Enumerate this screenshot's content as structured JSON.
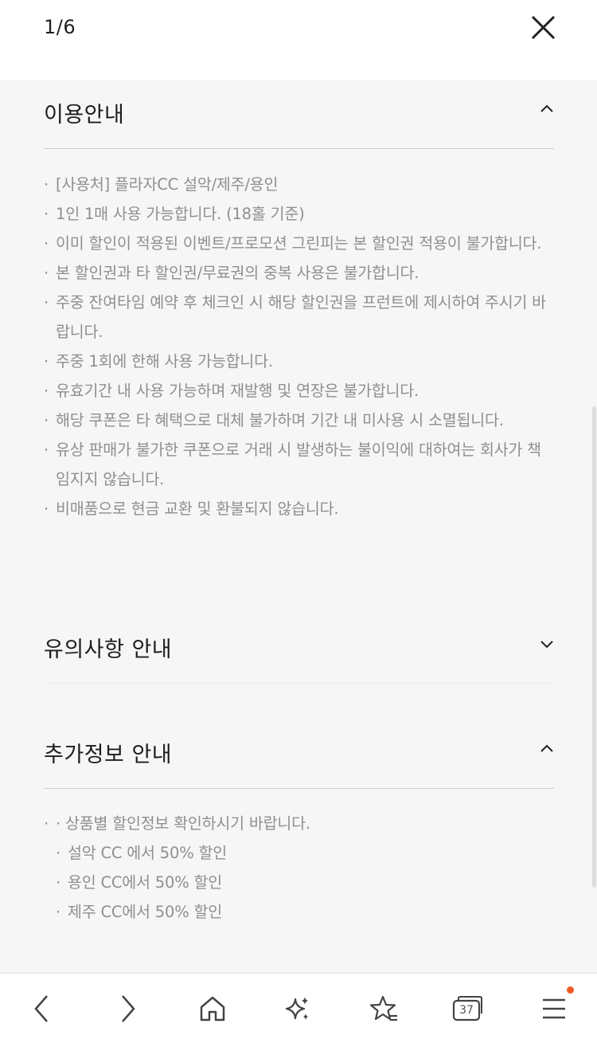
{
  "header": {
    "page_counter": "1/6",
    "close_icon": "close-icon"
  },
  "sections": {
    "usage": {
      "title": "이용안내",
      "state_icon": "chevron-up-icon",
      "items": [
        "[사용처] 플라자CC 설악/제주/용인",
        "1인 1매 사용 가능합니다. (18홀 기준)",
        "이미 할인이 적용된 이벤트/프로모션 그린피는 본 할인권 적용이 불가합니다.",
        "본 할인권과 타 할인권/무료권의 중복 사용은 불가합니다.",
        "주중 잔여타임 예약 후 체크인 시 해당 할인권을 프런트에 제시하여 주시기 바랍니다.",
        "주중 1회에 한해 사용 가능합니다.",
        "유효기간 내 사용 가능하며 재발행 및 연장은 불가합니다.",
        "해당 쿠폰은 타 혜택으로 대체 불가하며 기간 내 미사용 시 소멸됩니다.",
        "유상 판매가 불가한 쿠폰으로 거래 시 발생하는 불이익에 대하여는 회사가 책임지지 않습니다.",
        "비매품으로 현금 교환 및 환불되지 않습니다."
      ]
    },
    "caution": {
      "title": "유의사항 안내",
      "state_icon": "chevron-down-icon"
    },
    "extra": {
      "title": "추가정보 안내",
      "state_icon": "chevron-up-icon",
      "intro": "· 상품별 할인정보 확인하시기 바랍니다.",
      "items": [
        "설악 CC 에서 50% 할인",
        "용인 CC에서 50% 할인",
        "제주 CC에서 50% 할인"
      ]
    }
  },
  "bullet": "·",
  "bottom_nav": {
    "back_icon": "back-icon",
    "forward_icon": "forward-icon",
    "home_icon": "home-icon",
    "ai_icon": "sparkle-icon",
    "bookmark_icon": "star-icon",
    "tabs_count": "37",
    "menu_icon": "menu-icon"
  },
  "colors": {
    "accent_badge": "#f25a22",
    "body_text": "#8f8f8f",
    "background": "#f6f6f6"
  }
}
